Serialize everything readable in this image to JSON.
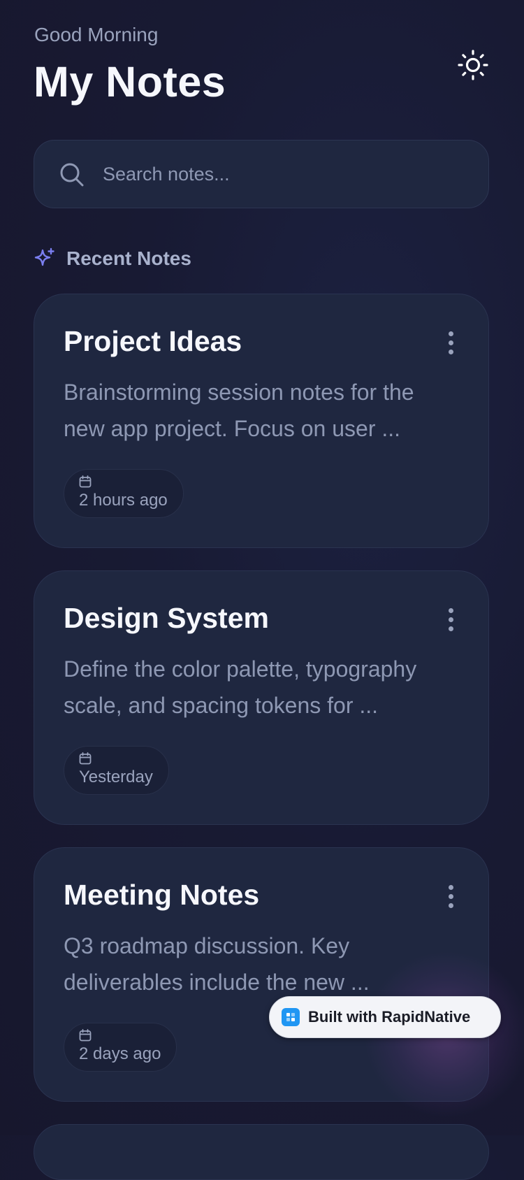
{
  "header": {
    "greeting": "Good Morning",
    "title": "My Notes",
    "theme_toggle_icon": "sun-icon"
  },
  "search": {
    "placeholder": "Search notes...",
    "value": "",
    "icon": "search-icon"
  },
  "section": {
    "title": "Recent Notes",
    "icon": "sparkles-icon"
  },
  "notes": [
    {
      "title": "Project Ideas",
      "excerpt": "Brainstorming session notes for the new app project. Focus on user ...",
      "date": "2 hours ago"
    },
    {
      "title": "Design System",
      "excerpt": "Define the color palette, typography scale, and spacing tokens for ...",
      "date": "Yesterday"
    },
    {
      "title": "Meeting Notes",
      "excerpt": "Q3 roadmap discussion. Key deliverables include the new ...",
      "date": "2 days ago"
    }
  ],
  "badge": {
    "label": "Built with RapidNative"
  },
  "colors": {
    "background": "#181a33",
    "card": "#1f2740",
    "accent": "#7b7ff0",
    "text_primary": "#f6f7fc",
    "text_secondary": "#8e98b3"
  }
}
